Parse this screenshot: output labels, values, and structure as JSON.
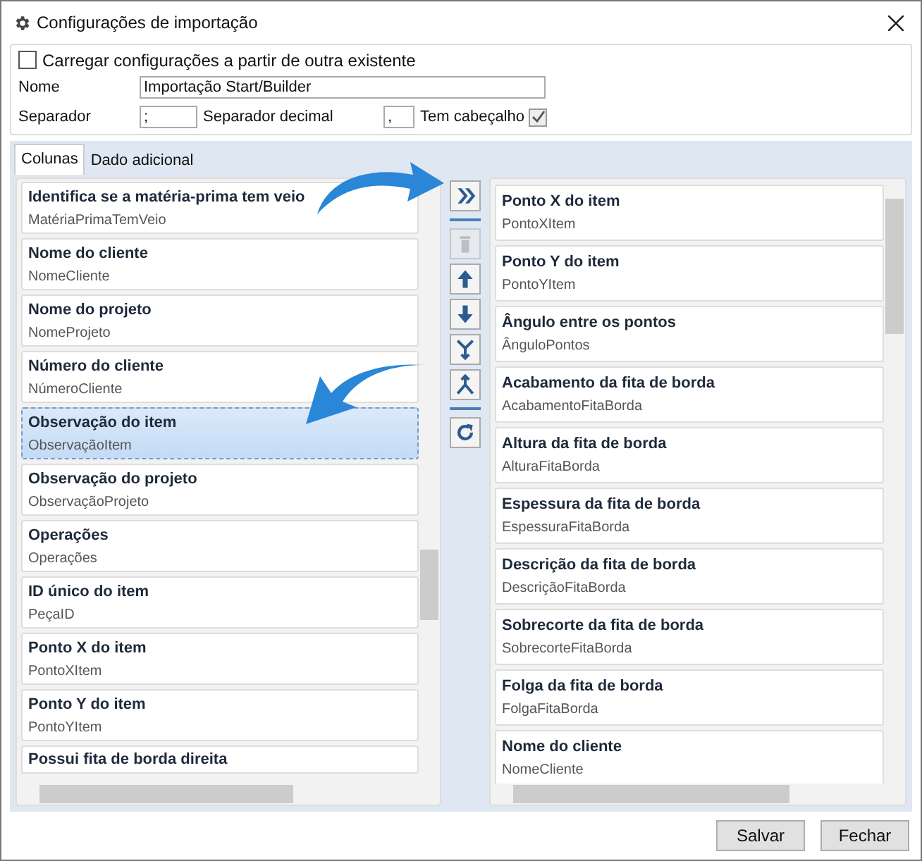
{
  "window": {
    "title": "Configurações de importação"
  },
  "load_existing": {
    "label": "Carregar configurações a partir de outra existente",
    "checked": false
  },
  "name_field": {
    "label": "Nome",
    "value": "Importação Start/Builder"
  },
  "separator": {
    "label": "Separador",
    "value": ";"
  },
  "decimal_separator": {
    "label": "Separador decimal",
    "value": ","
  },
  "has_header": {
    "label": "Tem cabeçalho",
    "checked": true
  },
  "tabs": [
    {
      "label": "Colunas",
      "selected": true
    },
    {
      "label": "Dado adicional",
      "selected": false
    }
  ],
  "available_columns": [
    {
      "title": "Identifica se a matéria-prima tem veio",
      "key": "MatériaPrimaTemVeio",
      "selected": false
    },
    {
      "title": "Nome do cliente",
      "key": "NomeCliente",
      "selected": false
    },
    {
      "title": "Nome do projeto",
      "key": "NomeProjeto",
      "selected": false
    },
    {
      "title": "Número do cliente",
      "key": "NúmeroCliente",
      "selected": false
    },
    {
      "title": "Observação do item",
      "key": "ObservaçãoItem",
      "selected": true
    },
    {
      "title": "Observação do projeto",
      "key": "ObservaçãoProjeto",
      "selected": false
    },
    {
      "title": "Operações",
      "key": "Operações",
      "selected": false
    },
    {
      "title": "ID único do item",
      "key": "PeçaID",
      "selected": false
    },
    {
      "title": "Ponto X do item",
      "key": "PontoXItem",
      "selected": false
    },
    {
      "title": "Ponto Y do item",
      "key": "PontoYItem",
      "selected": false
    },
    {
      "title": "Possui fita de borda direita",
      "selected": false
    }
  ],
  "toolbar": [
    {
      "kind": "add"
    },
    {
      "kind": "separator"
    },
    {
      "kind": "delete",
      "disabled": true
    },
    {
      "kind": "up",
      "disabled": false
    },
    {
      "kind": "down",
      "disabled": false
    },
    {
      "kind": "merge",
      "disabled": false
    },
    {
      "kind": "split",
      "disabled": false
    },
    {
      "kind": "separator"
    },
    {
      "kind": "refresh",
      "disabled": false
    }
  ],
  "selected_columns": [
    {
      "title": "Ponto X do item",
      "key": "PontoXItem"
    },
    {
      "title": "Ponto Y do item",
      "key": "PontoYItem"
    },
    {
      "title": "Ângulo entre os pontos",
      "key": "ÂnguloPontos"
    },
    {
      "title": "Acabamento da fita de borda",
      "key": "AcabamentoFitaBorda"
    },
    {
      "title": "Altura da fita de borda",
      "key": "AlturaFitaBorda"
    },
    {
      "title": "Espessura da fita de borda",
      "key": "EspessuraFitaBorda"
    },
    {
      "title": "Descrição da fita de borda",
      "key": "DescriçãoFitaBorda"
    },
    {
      "title": "Sobrecorte da fita de borda",
      "key": "SobrecorteFitaBorda"
    },
    {
      "title": "Folga da fita de borda",
      "key": "FolgaFitaBorda"
    },
    {
      "title": "Nome do cliente",
      "key": "NomeCliente"
    }
  ],
  "buttons": [
    "Salvar",
    "Fechar"
  ]
}
